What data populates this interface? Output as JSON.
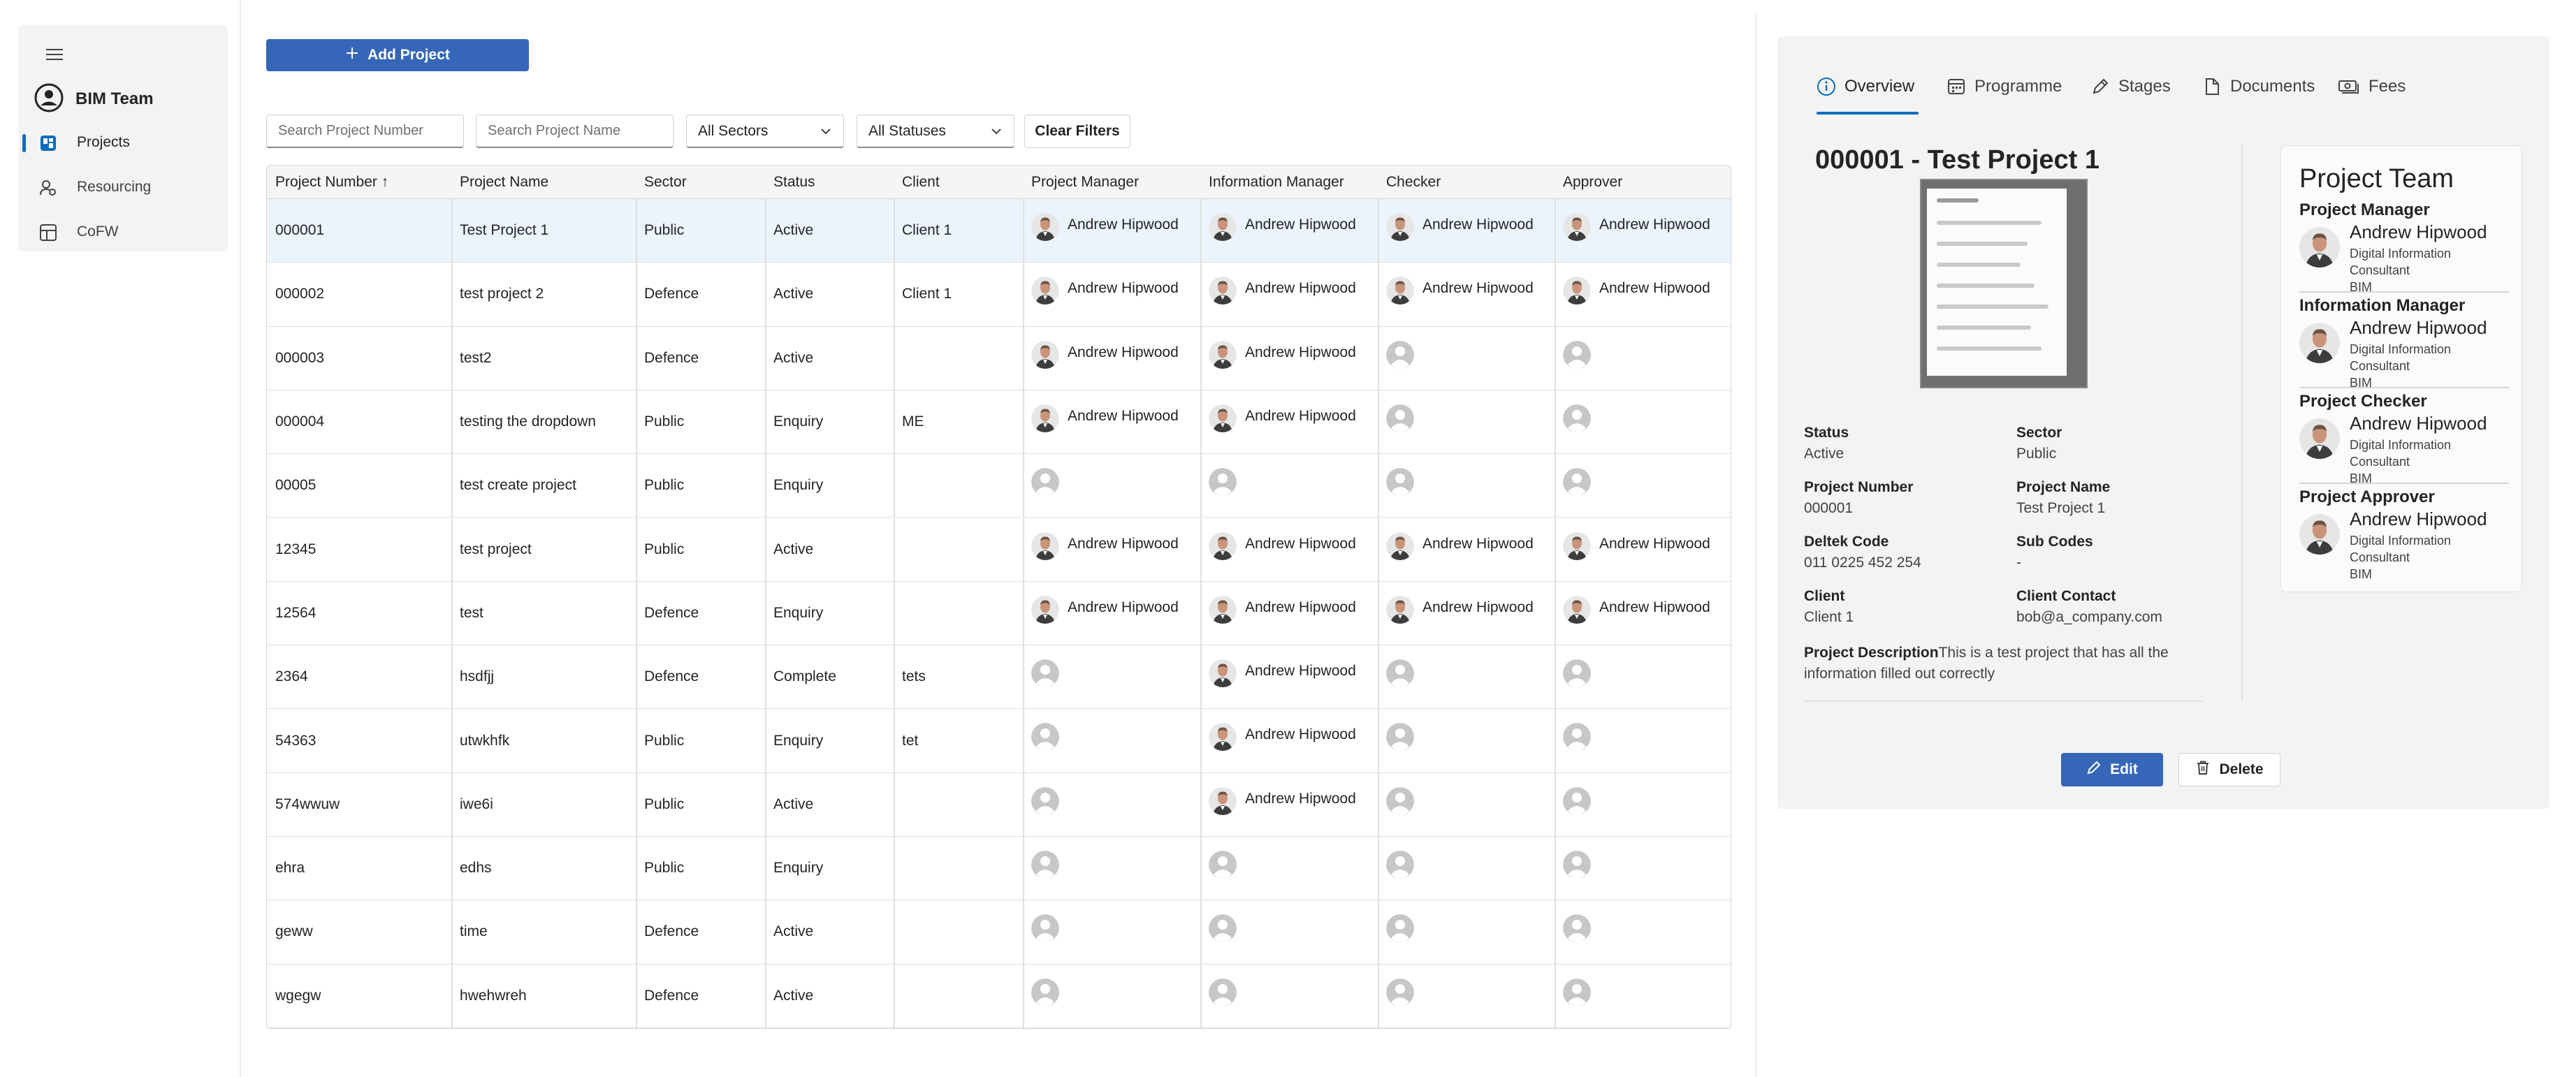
{
  "nav": {
    "brand": "BIM Team",
    "items": [
      {
        "label": "Projects",
        "icon": "projects-board-icon",
        "active": true
      },
      {
        "label": "Resourcing",
        "icon": "person-gear-icon",
        "active": false
      },
      {
        "label": "CoFW",
        "icon": "table-icon",
        "active": false
      }
    ]
  },
  "toolbar": {
    "add_label": "Add Project",
    "search_number_placeholder": "Search Project Number",
    "search_name_placeholder": "Search Project Name",
    "sectors_value": "All Sectors",
    "statuses_value": "All Statuses",
    "clear_label": "Clear Filters"
  },
  "table": {
    "columns": [
      "Project Number ↑",
      "Project Name",
      "Sector",
      "Status",
      "Client",
      "Project Manager",
      "Information Manager",
      "Checker",
      "Approver"
    ],
    "rows": [
      {
        "number": "000001",
        "name": "Test Project 1",
        "sector": "Public",
        "status": "Active",
        "client": "Client 1",
        "pm": "Andrew Hipwood",
        "im": "Andrew Hipwood",
        "checker": "Andrew Hipwood",
        "approver": "Andrew Hipwood",
        "selected": true
      },
      {
        "number": "000002",
        "name": "test project 2",
        "sector": "Defence",
        "status": "Active",
        "client": "Client 1",
        "pm": "Andrew Hipwood",
        "im": "Andrew Hipwood",
        "checker": "Andrew Hipwood",
        "approver": "Andrew Hipwood"
      },
      {
        "number": "000003",
        "name": "test2",
        "sector": "Defence",
        "status": "Active",
        "client": "",
        "pm": "Andrew Hipwood",
        "im": "Andrew Hipwood",
        "checker": "",
        "approver": ""
      },
      {
        "number": "000004",
        "name": "testing the dropdown",
        "sector": "Public",
        "status": "Enquiry",
        "client": "ME",
        "pm": "Andrew Hipwood",
        "im": "Andrew Hipwood",
        "checker": "",
        "approver": ""
      },
      {
        "number": "00005",
        "name": "test create project",
        "sector": "Public",
        "status": "Enquiry",
        "client": "",
        "pm": "",
        "im": "",
        "checker": "",
        "approver": ""
      },
      {
        "number": "12345",
        "name": "test project",
        "sector": "Public",
        "status": "Active",
        "client": "",
        "pm": "Andrew Hipwood",
        "im": "Andrew Hipwood",
        "checker": "Andrew Hipwood",
        "approver": "Andrew Hipwood"
      },
      {
        "number": "12564",
        "name": "test",
        "sector": "Defence",
        "status": "Enquiry",
        "client": "",
        "pm": "Andrew Hipwood",
        "im": "Andrew Hipwood",
        "checker": "Andrew Hipwood",
        "approver": "Andrew Hipwood"
      },
      {
        "number": "2364",
        "name": "hsdfjj",
        "sector": "Defence",
        "status": "Complete",
        "client": "tets",
        "pm": "",
        "im": "Andrew Hipwood",
        "checker": "",
        "approver": ""
      },
      {
        "number": "54363",
        "name": "utwkhfk",
        "sector": "Public",
        "status": "Enquiry",
        "client": "tet",
        "pm": "",
        "im": "Andrew Hipwood",
        "checker": "",
        "approver": ""
      },
      {
        "number": "574wwuw",
        "name": "iwe6i",
        "sector": "Public",
        "status": "Active",
        "client": "",
        "pm": "",
        "im": "Andrew Hipwood",
        "checker": "",
        "approver": ""
      },
      {
        "number": "ehra",
        "name": "edhs",
        "sector": "Public",
        "status": "Enquiry",
        "client": "",
        "pm": "",
        "im": "",
        "checker": "",
        "approver": ""
      },
      {
        "number": "geww",
        "name": "time",
        "sector": "Defence",
        "status": "Active",
        "client": "",
        "pm": "",
        "im": "",
        "checker": "",
        "approver": ""
      },
      {
        "number": "wgegw",
        "name": "hwehwreh",
        "sector": "Defence",
        "status": "Active",
        "client": "",
        "pm": "",
        "im": "",
        "checker": "",
        "approver": ""
      }
    ]
  },
  "detail": {
    "tabs": [
      {
        "label": "Overview",
        "icon": "info-icon",
        "active": true
      },
      {
        "label": "Programme",
        "icon": "calendar-icon"
      },
      {
        "label": "Stages",
        "icon": "pencil-icon"
      },
      {
        "label": "Documents",
        "icon": "document-icon"
      },
      {
        "label": "Fees",
        "icon": "money-icon"
      }
    ],
    "title": "000001 - Test Project 1",
    "fields": {
      "status_label": "Status",
      "status_value": "Active",
      "sector_label": "Sector",
      "sector_value": "Public",
      "number_label": "Project Number",
      "number_value": "000001",
      "name_label": "Project Name",
      "name_value": "Test Project 1",
      "deltek_label": "Deltek Code",
      "deltek_value": "011 0225 452 254",
      "subcodes_label": "Sub Codes",
      "subcodes_value": "-",
      "client_label": "Client",
      "client_value": "Client 1",
      "contact_label": "Client Contact",
      "contact_value": "bob@a_company.com",
      "description_label": "Project Description",
      "description_value": "This is a test project that has all the information filled out correctly"
    },
    "team": {
      "title": "Project Team",
      "roles": [
        {
          "role": "Project Manager",
          "name": "Andrew Hipwood",
          "job": "Digital Information Consultant",
          "dept": "BIM"
        },
        {
          "role": "Information Manager",
          "name": "Andrew Hipwood",
          "job": "Digital Information Consultant",
          "dept": "BIM"
        },
        {
          "role": "Project Checker",
          "name": "Andrew Hipwood",
          "job": "Digital Information Consultant",
          "dept": "BIM"
        },
        {
          "role": "Project Approver",
          "name": "Andrew Hipwood",
          "job": "Digital Information Consultant",
          "dept": "BIM"
        }
      ]
    },
    "edit_label": "Edit",
    "delete_label": "Delete"
  },
  "colors": {
    "accent": "#3566b8",
    "selected_row": "#ebf3fc",
    "panel_bg": "#f3f3f3"
  }
}
